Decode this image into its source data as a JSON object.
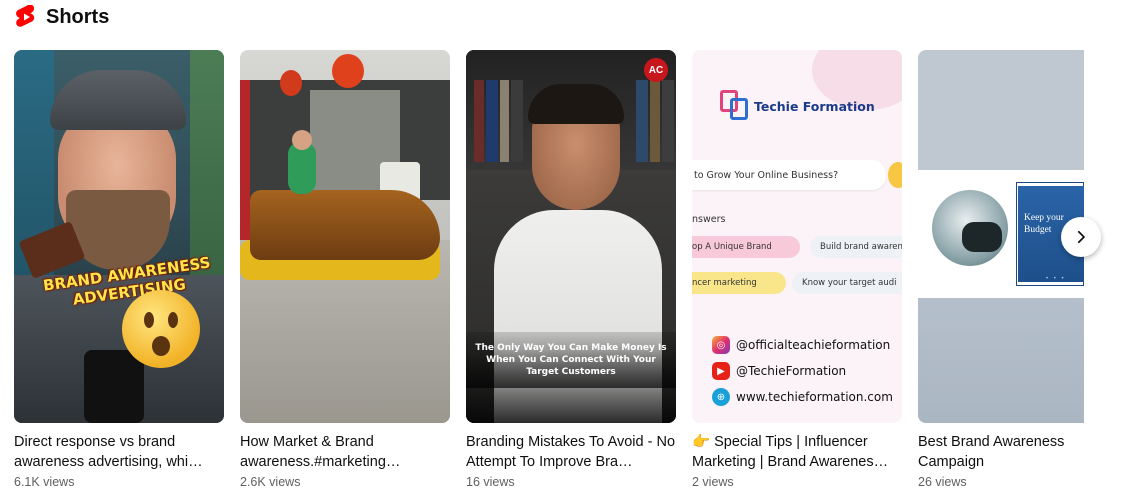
{
  "section": {
    "title": "Shorts",
    "icon": "shorts-logo-icon"
  },
  "colors": {
    "brand_red": "#ff0000",
    "text": "#0f0f0f",
    "meta": "#606060"
  },
  "cards": [
    {
      "title": "Direct response vs brand awareness advertising, whi…",
      "views": "6.1K views",
      "thumb_text": "BRAND AWARENESS ADVERTISING"
    },
    {
      "title": "How Market & Brand awareness.#marketing…",
      "views": "2.6K views"
    },
    {
      "title": "Branding Mistakes To Avoid - No Attempt To Improve Bra…",
      "views": "16 views",
      "thumb_badge": "AC",
      "thumb_caption": "The Only Way You Can Make Money Is When You Can Connect With Your Target Customers"
    },
    {
      "title": "👉 Special Tips | Influencer Marketing | Brand Awarenes…",
      "views": "2 views",
      "thumb_brand": "Techie Formation",
      "thumb_question": "to Grow Your Online Business?",
      "thumb_answers_label": "nswers",
      "thumb_pills": [
        "op A Unique Brand",
        "Build brand awaren",
        "ncer marketing",
        "Know your target audi"
      ],
      "thumb_social": [
        "@officialteachieformation",
        "@TechieFormation",
        "www.techieformation.com"
      ]
    },
    {
      "title": "Best Brand Awareness Campaign",
      "views": "26 views",
      "thumb_panel_text": "Keep your Budget"
    }
  ],
  "next_button": {
    "icon": "chevron-right-icon"
  }
}
